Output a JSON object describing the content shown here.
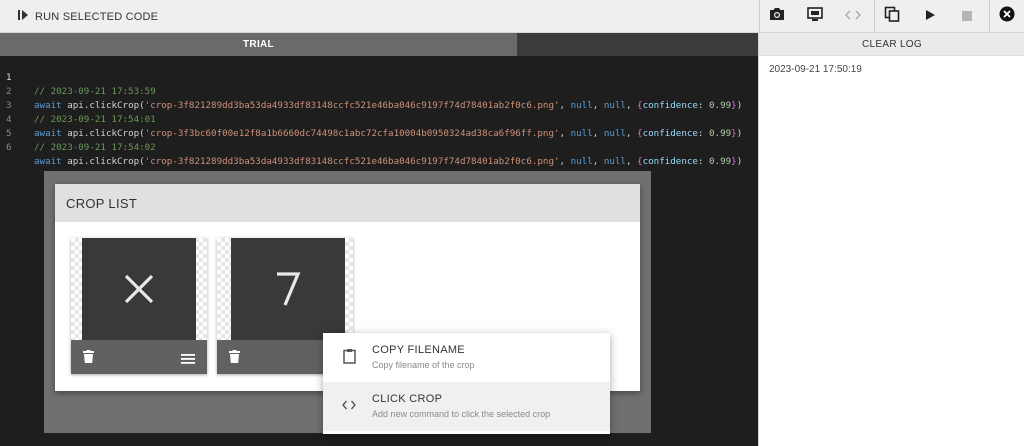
{
  "toolbar": {
    "run_label": "RUN SELECTED CODE",
    "icons": [
      "camera-icon",
      "screen-capture-icon",
      "code-icon",
      "copy-icon",
      "play-icon",
      "stop-icon",
      "close-icon"
    ]
  },
  "editor": {
    "tab_label": "TRIAL",
    "lines": [
      {
        "num": "1",
        "comment": "// 2023-09-21 17:53:59"
      },
      {
        "num": "2",
        "kw": "await",
        "obj": "api.clickCrop(",
        "str": "'crop-3f821289dd3ba53da4933df83148ccfc521e46ba046c9197f74d78401ab2f0c6.png'",
        "sep1": ", ",
        "null1": "null",
        "sep2": ", ",
        "null2": "null",
        "sep3": ", ",
        "brace_open": "{",
        "key": "confidence",
        "colon": ": ",
        "num_val": "0.99",
        "brace_close": "}",
        "end": ")"
      },
      {
        "num": "3",
        "comment": "// 2023-09-21 17:54:01"
      },
      {
        "num": "4",
        "kw": "await",
        "obj": "api.clickCrop(",
        "str": "'crop-3f3bc60f00e12f8a1b6660dc74498c1abc72cfa10004b0950324ad38ca6f96ff.png'",
        "sep1": ", ",
        "null1": "null",
        "sep2": ", ",
        "null2": "null",
        "sep3": ", ",
        "brace_open": "{",
        "key": "confidence",
        "colon": ": ",
        "num_val": "0.99",
        "brace_close": "}",
        "end": ")"
      },
      {
        "num": "5",
        "comment": "// 2023-09-21 17:54:02"
      },
      {
        "num": "6",
        "kw": "await",
        "obj": "api.clickCrop(",
        "str": "'crop-3f821289dd3ba53da4933df83148ccfc521e46ba046c9197f74d78401ab2f0c6.png'",
        "sep1": ", ",
        "null1": "null",
        "sep2": ", ",
        "null2": "null",
        "sep3": ", ",
        "brace_open": "{",
        "key": "confidence",
        "colon": ": ",
        "num_val": "0.99",
        "brace_close": "}",
        "end": ")"
      }
    ]
  },
  "log": {
    "clear_label": "CLEAR LOG",
    "entries": [
      "2023-09-21 17:50:19"
    ]
  },
  "crop_list": {
    "title": "CROP LIST",
    "crops": [
      {
        "glyph": "✕"
      },
      {
        "glyph": "7"
      }
    ]
  },
  "context_menu": {
    "items": [
      {
        "title": "COPY FILENAME",
        "subtitle": "Copy filename of the crop"
      },
      {
        "title": "CLICK CROP",
        "subtitle": "Add new command to click the selected crop"
      }
    ]
  }
}
